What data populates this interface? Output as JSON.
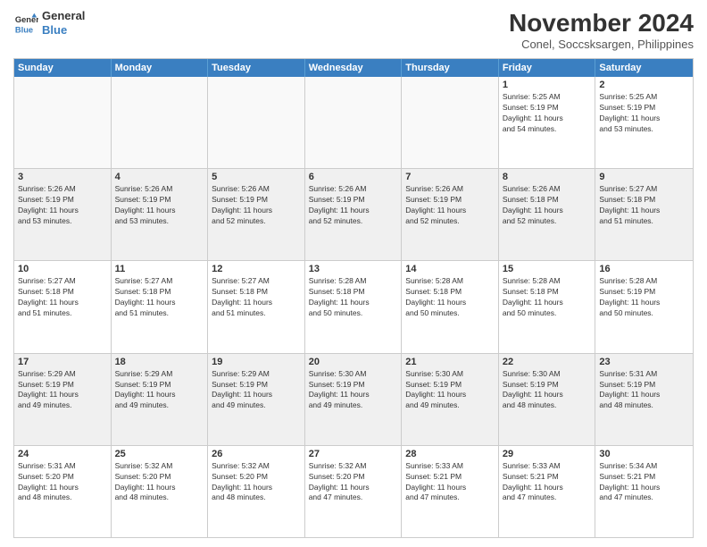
{
  "logo": {
    "line1": "General",
    "line2": "Blue"
  },
  "header": {
    "month": "November 2024",
    "location": "Conel, Soccsksargen, Philippines"
  },
  "days": [
    "Sunday",
    "Monday",
    "Tuesday",
    "Wednesday",
    "Thursday",
    "Friday",
    "Saturday"
  ],
  "weeks": [
    [
      {
        "day": "",
        "text": ""
      },
      {
        "day": "",
        "text": ""
      },
      {
        "day": "",
        "text": ""
      },
      {
        "day": "",
        "text": ""
      },
      {
        "day": "",
        "text": ""
      },
      {
        "day": "1",
        "text": "Sunrise: 5:25 AM\nSunset: 5:19 PM\nDaylight: 11 hours\nand 54 minutes."
      },
      {
        "day": "2",
        "text": "Sunrise: 5:25 AM\nSunset: 5:19 PM\nDaylight: 11 hours\nand 53 minutes."
      }
    ],
    [
      {
        "day": "3",
        "text": "Sunrise: 5:26 AM\nSunset: 5:19 PM\nDaylight: 11 hours\nand 53 minutes."
      },
      {
        "day": "4",
        "text": "Sunrise: 5:26 AM\nSunset: 5:19 PM\nDaylight: 11 hours\nand 53 minutes."
      },
      {
        "day": "5",
        "text": "Sunrise: 5:26 AM\nSunset: 5:19 PM\nDaylight: 11 hours\nand 52 minutes."
      },
      {
        "day": "6",
        "text": "Sunrise: 5:26 AM\nSunset: 5:19 PM\nDaylight: 11 hours\nand 52 minutes."
      },
      {
        "day": "7",
        "text": "Sunrise: 5:26 AM\nSunset: 5:19 PM\nDaylight: 11 hours\nand 52 minutes."
      },
      {
        "day": "8",
        "text": "Sunrise: 5:26 AM\nSunset: 5:18 PM\nDaylight: 11 hours\nand 52 minutes."
      },
      {
        "day": "9",
        "text": "Sunrise: 5:27 AM\nSunset: 5:18 PM\nDaylight: 11 hours\nand 51 minutes."
      }
    ],
    [
      {
        "day": "10",
        "text": "Sunrise: 5:27 AM\nSunset: 5:18 PM\nDaylight: 11 hours\nand 51 minutes."
      },
      {
        "day": "11",
        "text": "Sunrise: 5:27 AM\nSunset: 5:18 PM\nDaylight: 11 hours\nand 51 minutes."
      },
      {
        "day": "12",
        "text": "Sunrise: 5:27 AM\nSunset: 5:18 PM\nDaylight: 11 hours\nand 51 minutes."
      },
      {
        "day": "13",
        "text": "Sunrise: 5:28 AM\nSunset: 5:18 PM\nDaylight: 11 hours\nand 50 minutes."
      },
      {
        "day": "14",
        "text": "Sunrise: 5:28 AM\nSunset: 5:18 PM\nDaylight: 11 hours\nand 50 minutes."
      },
      {
        "day": "15",
        "text": "Sunrise: 5:28 AM\nSunset: 5:18 PM\nDaylight: 11 hours\nand 50 minutes."
      },
      {
        "day": "16",
        "text": "Sunrise: 5:28 AM\nSunset: 5:19 PM\nDaylight: 11 hours\nand 50 minutes."
      }
    ],
    [
      {
        "day": "17",
        "text": "Sunrise: 5:29 AM\nSunset: 5:19 PM\nDaylight: 11 hours\nand 49 minutes."
      },
      {
        "day": "18",
        "text": "Sunrise: 5:29 AM\nSunset: 5:19 PM\nDaylight: 11 hours\nand 49 minutes."
      },
      {
        "day": "19",
        "text": "Sunrise: 5:29 AM\nSunset: 5:19 PM\nDaylight: 11 hours\nand 49 minutes."
      },
      {
        "day": "20",
        "text": "Sunrise: 5:30 AM\nSunset: 5:19 PM\nDaylight: 11 hours\nand 49 minutes."
      },
      {
        "day": "21",
        "text": "Sunrise: 5:30 AM\nSunset: 5:19 PM\nDaylight: 11 hours\nand 49 minutes."
      },
      {
        "day": "22",
        "text": "Sunrise: 5:30 AM\nSunset: 5:19 PM\nDaylight: 11 hours\nand 48 minutes."
      },
      {
        "day": "23",
        "text": "Sunrise: 5:31 AM\nSunset: 5:19 PM\nDaylight: 11 hours\nand 48 minutes."
      }
    ],
    [
      {
        "day": "24",
        "text": "Sunrise: 5:31 AM\nSunset: 5:20 PM\nDaylight: 11 hours\nand 48 minutes."
      },
      {
        "day": "25",
        "text": "Sunrise: 5:32 AM\nSunset: 5:20 PM\nDaylight: 11 hours\nand 48 minutes."
      },
      {
        "day": "26",
        "text": "Sunrise: 5:32 AM\nSunset: 5:20 PM\nDaylight: 11 hours\nand 48 minutes."
      },
      {
        "day": "27",
        "text": "Sunrise: 5:32 AM\nSunset: 5:20 PM\nDaylight: 11 hours\nand 47 minutes."
      },
      {
        "day": "28",
        "text": "Sunrise: 5:33 AM\nSunset: 5:21 PM\nDaylight: 11 hours\nand 47 minutes."
      },
      {
        "day": "29",
        "text": "Sunrise: 5:33 AM\nSunset: 5:21 PM\nDaylight: 11 hours\nand 47 minutes."
      },
      {
        "day": "30",
        "text": "Sunrise: 5:34 AM\nSunset: 5:21 PM\nDaylight: 11 hours\nand 47 minutes."
      }
    ]
  ]
}
